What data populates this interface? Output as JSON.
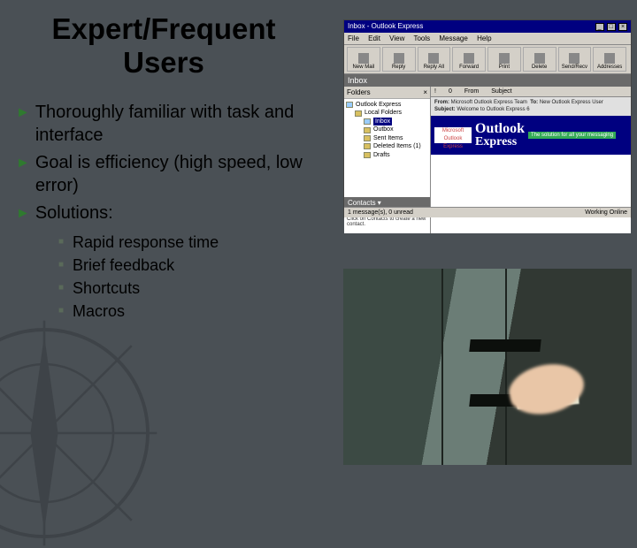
{
  "title_line1": "Expert/Frequent",
  "title_line2": "Users",
  "bullets": [
    "Thoroughly familiar with task and interface",
    "Goal is efficiency (high speed, low error)",
    "Solutions:"
  ],
  "sub_bullets": [
    "Rapid response time",
    "Brief feedback",
    "Shortcuts",
    "Macros"
  ],
  "app_shot": {
    "window_title": "Inbox - Outlook Express",
    "menu": [
      "File",
      "Edit",
      "View",
      "Tools",
      "Message",
      "Help"
    ],
    "toolbar": [
      "New Mail",
      "Reply",
      "Reply All",
      "Forward",
      "Print",
      "Delete",
      "Send/Recv",
      "Addresses"
    ],
    "inbox_header": "Inbox",
    "folders_label": "Folders",
    "tree": {
      "root": "Outlook Express",
      "local": "Local Folders",
      "items": [
        "Inbox",
        "Outbox",
        "Sent Items",
        "Deleted Items (1)",
        "Drafts"
      ]
    },
    "contacts_header": "Contacts ▾",
    "contacts_empty": "There are no contacts to display. Click on Contacts to create a new contact.",
    "list_columns": [
      "!",
      "0",
      "From",
      "Subject"
    ],
    "welcome_banner": "Microsoft Outlook Express",
    "welcome_brand1": "Outlook",
    "welcome_brand2": "Express",
    "welcome_tag": "The solution for all your messaging",
    "meta_from_label": "From:",
    "meta_from": "Microsoft Outlook Express Team",
    "meta_to_label": "To:",
    "meta_to": "New Outlook Express User",
    "meta_subj_label": "Subject:",
    "meta_subj": "Welcome to Outlook Express 6",
    "status_left": "1 message(s), 0 unread",
    "status_right": "Working Online"
  }
}
